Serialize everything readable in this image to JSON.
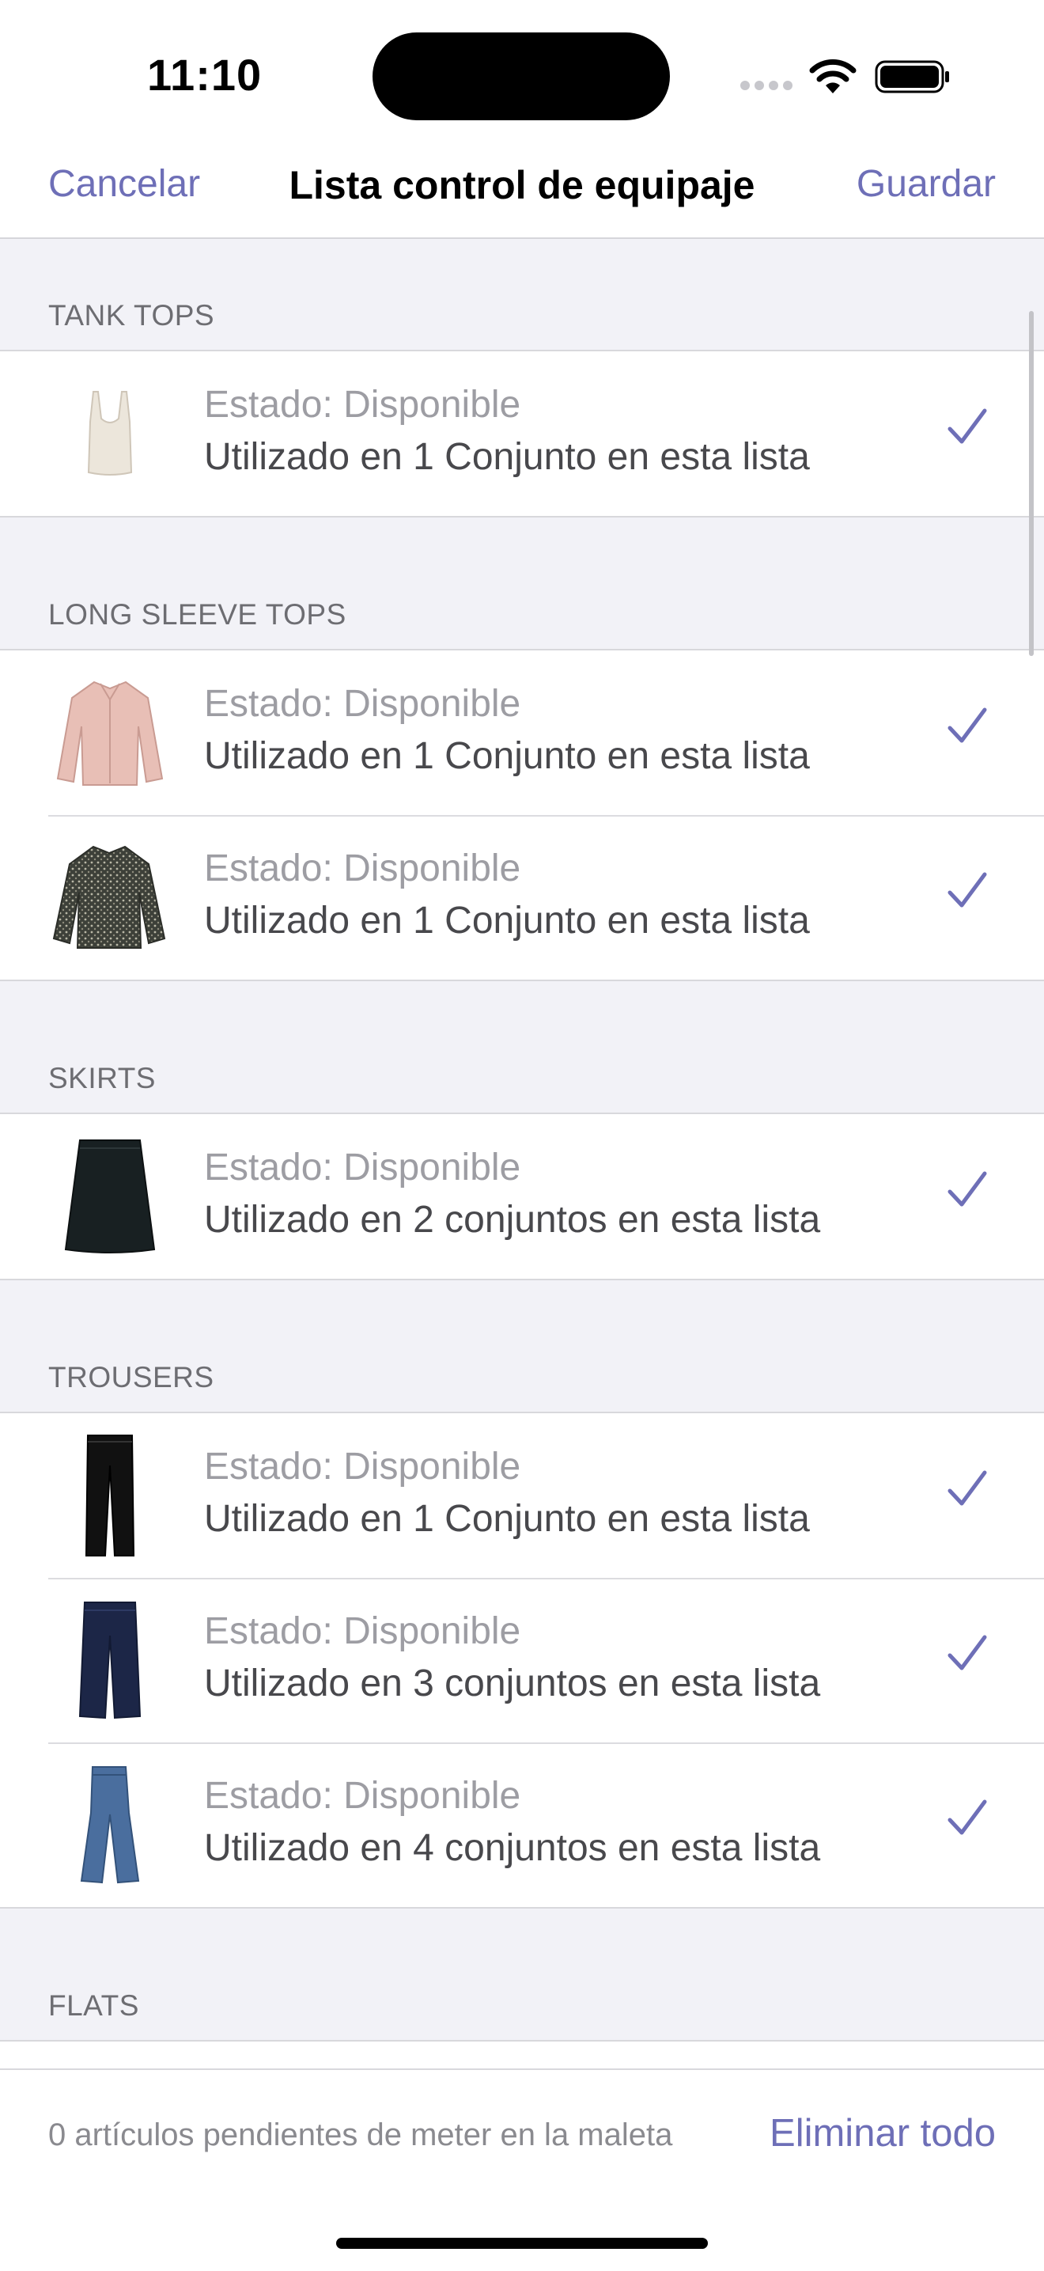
{
  "status_bar": {
    "time": "11:10"
  },
  "nav": {
    "cancel": "Cancelar",
    "title": "Lista control de equipaje",
    "save": "Guardar"
  },
  "colors": {
    "accent": "#6e6fb7",
    "background": "#f2f2f7",
    "secondary_text": "#9d9da3"
  },
  "sections": [
    {
      "header": "TANK TOPS",
      "items": [
        {
          "status": "Estado: Disponible",
          "usage": "Utilizado en 1 Conjunto en esta lista",
          "icon": "tank-top-icon"
        }
      ]
    },
    {
      "header": "LONG SLEEVE TOPS",
      "items": [
        {
          "status": "Estado: Disponible",
          "usage": "Utilizado en 1 Conjunto en esta lista",
          "icon": "pink-shirt-icon"
        },
        {
          "status": "Estado: Disponible",
          "usage": "Utilizado en 1 Conjunto en esta lista",
          "icon": "patterned-blouse-icon"
        }
      ]
    },
    {
      "header": "SKIRTS",
      "items": [
        {
          "status": "Estado: Disponible",
          "usage": "Utilizado en 2 conjuntos en esta lista",
          "icon": "black-skirt-icon"
        }
      ]
    },
    {
      "header": "TROUSERS",
      "items": [
        {
          "status": "Estado: Disponible",
          "usage": "Utilizado en 1 Conjunto en esta lista",
          "icon": "black-trousers-icon"
        },
        {
          "status": "Estado: Disponible",
          "usage": "Utilizado en 3 conjuntos en esta lista",
          "icon": "navy-trousers-icon"
        },
        {
          "status": "Estado: Disponible",
          "usage": "Utilizado en 4 conjuntos en esta lista",
          "icon": "jeans-icon"
        }
      ]
    },
    {
      "header": "FLATS",
      "items": []
    }
  ],
  "bottom": {
    "pending": "0 artículos pendientes de meter en la maleta",
    "delete_all": "Eliminar todo"
  }
}
